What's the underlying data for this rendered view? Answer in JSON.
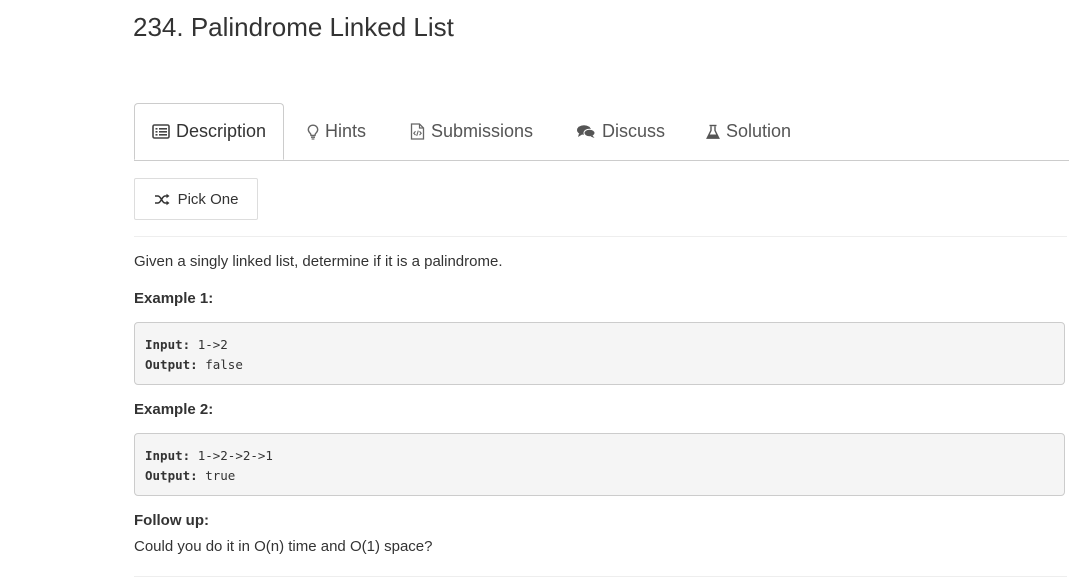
{
  "problem": {
    "title": "234. Palindrome Linked List"
  },
  "tabs": [
    {
      "label": "Description",
      "icon": "list-icon",
      "active": true
    },
    {
      "label": "Hints",
      "icon": "lightbulb-icon",
      "active": false
    },
    {
      "label": "Submissions",
      "icon": "code-file-icon",
      "active": false
    },
    {
      "label": "Discuss",
      "icon": "comments-icon",
      "active": false
    },
    {
      "label": "Solution",
      "icon": "flask-icon",
      "active": false
    }
  ],
  "pick_one": {
    "label": "Pick One",
    "icon": "shuffle-icon"
  },
  "description": {
    "intro": "Given a singly linked list, determine if it is a palindrome.",
    "example1_heading": "Example 1:",
    "example1": {
      "input_label": "Input:",
      "input_value": "1->2",
      "output_label": "Output:",
      "output_value": "false"
    },
    "example2_heading": "Example 2:",
    "example2": {
      "input_label": "Input:",
      "input_value": "1->2->2->1",
      "output_label": "Output:",
      "output_value": "true"
    },
    "followup_heading": "Follow up:",
    "followup_text": "Could you do it in O(n) time and O(1) space?"
  }
}
